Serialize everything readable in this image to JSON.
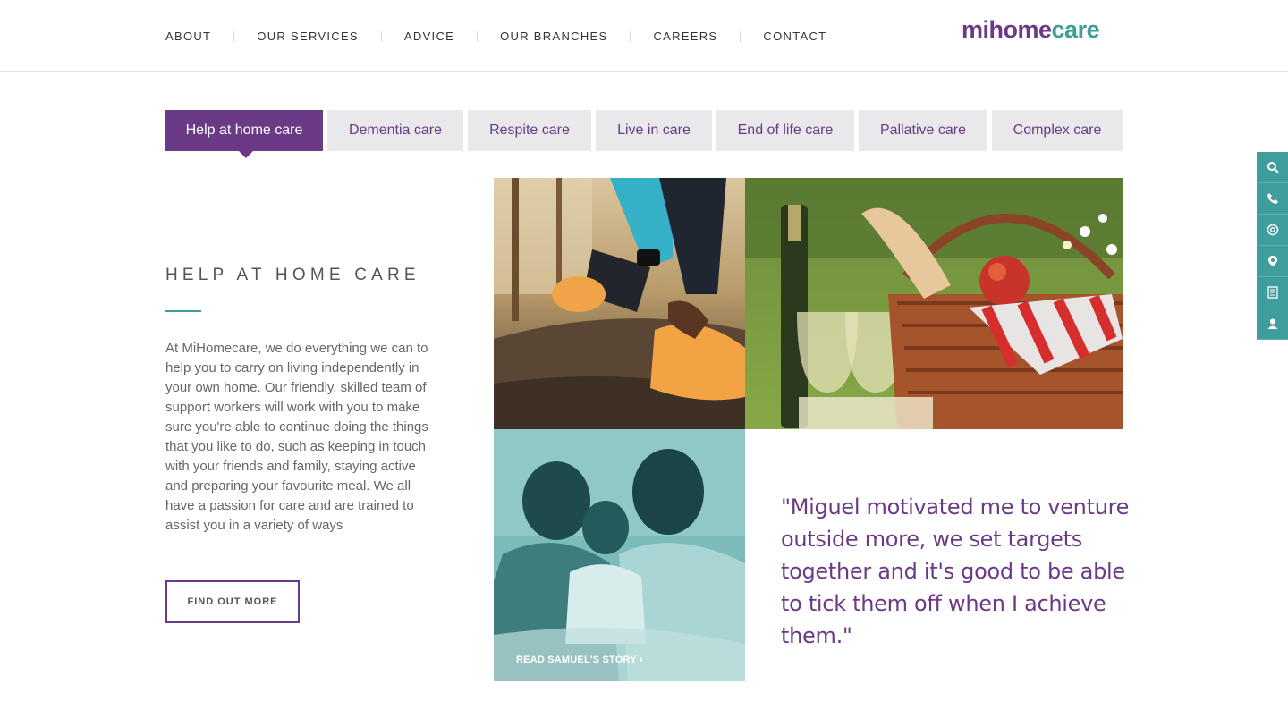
{
  "nav": {
    "items": [
      "ABOUT",
      "OUR SERVICES",
      "ADVICE",
      "OUR BRANCHES",
      "CAREERS",
      "CONTACT"
    ]
  },
  "logo": {
    "part1": "mi",
    "part2": "home",
    "part3": "care"
  },
  "tabs": [
    {
      "label": "Help at home care",
      "active": true
    },
    {
      "label": "Dementia care",
      "active": false
    },
    {
      "label": "Respite care",
      "active": false
    },
    {
      "label": "Live in care",
      "active": false
    },
    {
      "label": "End of life care",
      "active": false
    },
    {
      "label": "Pallative care",
      "active": false
    },
    {
      "label": "Complex care",
      "active": false
    }
  ],
  "section": {
    "title": "HELP AT HOME CARE",
    "body": "At MiHomecare, we do everything we can to help you to carry on living independently in your own home. Our friendly, skilled team of support workers will work with you to make sure you're able to continue doing the things that you like to do, such as keeping in touch with your friends and family, staying active and preparing your favourite meal. We all have a passion for care and are trained to assist you in a variety of ways",
    "button": "FIND OUT MORE"
  },
  "story": {
    "link": "READ SAMUEL'S STORY"
  },
  "quote": "\"Miguel motivated me to venture outside more, we set targets together and it's good to be able to tick them off when I achieve them.\"",
  "sidebar": {
    "icons": [
      "search-icon",
      "phone-icon",
      "email-icon",
      "location-icon",
      "document-icon",
      "user-icon"
    ]
  },
  "colors": {
    "brand_purple": "#6b3a87",
    "brand_teal": "#3f9e9c",
    "tab_bg": "#e9e9ec"
  }
}
